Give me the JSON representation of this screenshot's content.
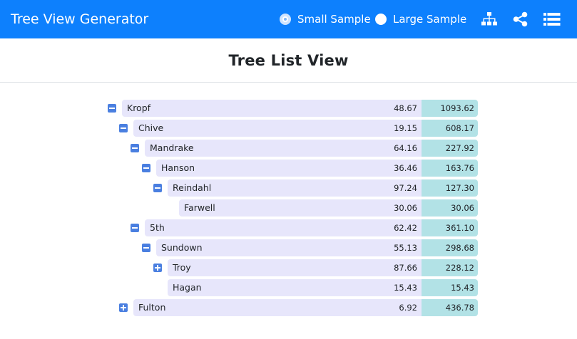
{
  "navbar": {
    "brand": "Tree View Generator",
    "options": [
      {
        "label": "Small Sample",
        "checked": true
      },
      {
        "label": "Large Sample",
        "checked": false
      }
    ],
    "icons": [
      "sitemap-icon",
      "share-icon",
      "list-icon"
    ]
  },
  "page": {
    "title": "Tree List View"
  },
  "tree": [
    {
      "name": "Kropf",
      "value": "48.67",
      "total": "1093.62",
      "level": 0,
      "toggle": "minus"
    },
    {
      "name": "Chive",
      "value": "19.15",
      "total": "608.17",
      "level": 1,
      "toggle": "minus"
    },
    {
      "name": "Mandrake",
      "value": "64.16",
      "total": "227.92",
      "level": 2,
      "toggle": "minus"
    },
    {
      "name": "Hanson",
      "value": "36.46",
      "total": "163.76",
      "level": 3,
      "toggle": "minus"
    },
    {
      "name": "Reindahl",
      "value": "97.24",
      "total": "127.30",
      "level": 4,
      "toggle": "minus"
    },
    {
      "name": "Farwell",
      "value": "30.06",
      "total": "30.06",
      "level": 5,
      "toggle": "none"
    },
    {
      "name": "5th",
      "value": "62.42",
      "total": "361.10",
      "level": 2,
      "toggle": "minus"
    },
    {
      "name": "Sundown",
      "value": "55.13",
      "total": "298.68",
      "level": 3,
      "toggle": "minus"
    },
    {
      "name": "Troy",
      "value": "87.66",
      "total": "228.12",
      "level": 4,
      "toggle": "plus"
    },
    {
      "name": "Hagan",
      "value": "15.43",
      "total": "15.43",
      "level": 4,
      "toggle": "none"
    },
    {
      "name": "Fulton",
      "value": "6.92",
      "total": "436.78",
      "level": 1,
      "toggle": "plus"
    }
  ]
}
